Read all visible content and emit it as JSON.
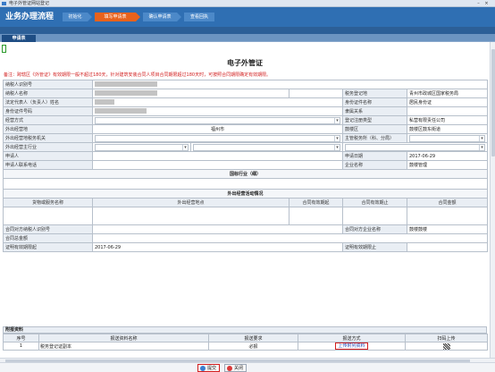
{
  "window": {
    "title": "电子外管证网站登记"
  },
  "flow": {
    "title": "业务办理流程",
    "steps": [
      "初始化",
      "填写申请表",
      "确认申请表",
      "查看回执"
    ]
  },
  "tab": {
    "label": "申请表"
  },
  "doc": {
    "title": "电子外管证",
    "notice": "备注：跨辖区《外管证》有效期限一般不超过180天，针对建筑安装合同人项目合同期限超过180天时，可按照合同期限确定有效期限。"
  },
  "form": {
    "labels": {
      "applicant_id": "纳税人识别号",
      "taxpayer_name": "纳税人名称",
      "legal_rep": "法定代表人（负责人）姓名",
      "id_type": "身份证件名称",
      "id_no": "身份证件号码",
      "region": "隶属关系",
      "reg_type": "登记注册类型",
      "reg_method": "经营方式",
      "tax_auth": "税务登记地",
      "outside_place": "外出经营地",
      "outside_auth": "外出经营地税务机关",
      "outside_industry": "外出经营主行业",
      "reg_address": "登记地区",
      "dept": "主管税务所（科、分局）",
      "applicant": "申请人",
      "apply_date": "申请日期",
      "phone": "申请人联系电话",
      "corp_name": "企业名称",
      "industry_detail": "国标行业（细）",
      "outside_activity": "外出经营活动情况",
      "goods_name": "货物或服务名称",
      "outside_addr": "外出经营地点",
      "contract_begin": "合同有效期起",
      "contract_end": "合同有效期止",
      "contract_amount": "合同金额",
      "counterparty_id": "合同对方纳税人识别号",
      "counterparty_name": "合同对方企业名称",
      "contract_total": "合同总金额",
      "valid_from": "证明有效期限起",
      "valid_to": "证明有效期限止"
    },
    "values": {
      "tax_place": "青州市政城区国家税务局",
      "id_type": "居民身份证",
      "reg_type": "私营有限责任公司",
      "outside_place": "福州市",
      "reg_area": "鼓楼区",
      "reg_area_detail": "鼓楼区鼓东街道",
      "apply_date": "2017-06-29",
      "corp_short": "鼓楼管理",
      "counterparty": "鼓楼鼓楼",
      "valid_from": "2017-06-29"
    }
  },
  "attachments": {
    "title": "附报资料",
    "headers": [
      "序号",
      "报送资料名称",
      "报送要求",
      "报送方式",
      "扫码上传"
    ],
    "rows": [
      {
        "no": "1",
        "name": "税务登记证副本",
        "req": "必报",
        "upload": "上传附列资料"
      }
    ]
  },
  "buttons": {
    "submit": "提交",
    "close": "关闭"
  },
  "colors": {
    "header": "#2f6fb3",
    "active_step": "#e8621c",
    "notice": "#d21f1f"
  }
}
